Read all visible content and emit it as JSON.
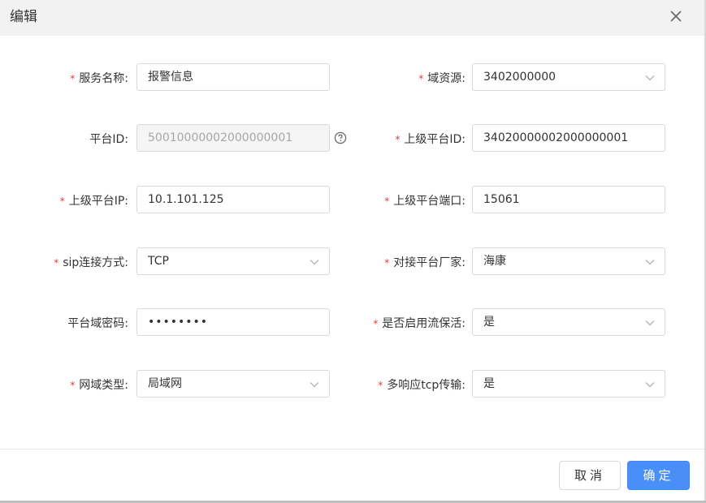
{
  "dialog": {
    "title": "编辑",
    "close_icon": "close-icon"
  },
  "form": {
    "service_name": {
      "label": "服务名称:",
      "required": true,
      "value": "报警信息"
    },
    "domain_source": {
      "label": "域资源:",
      "required": true,
      "value": "3402000000"
    },
    "platform_id": {
      "label": "平台ID:",
      "required": false,
      "value": "50010000002000000001",
      "disabled": true,
      "help_icon": "question-circle-icon"
    },
    "parent_platform_id": {
      "label": "上级平台ID:",
      "required": true,
      "value": "34020000002000000001"
    },
    "parent_platform_ip": {
      "label": "上级平台IP:",
      "required": true,
      "value": "10.1.101.125"
    },
    "parent_platform_port": {
      "label": "上级平台端口:",
      "required": true,
      "value": "15061"
    },
    "sip_connection": {
      "label": "sip连接方式:",
      "required": true,
      "value": "TCP"
    },
    "platform_vendor": {
      "label": "对接平台厂家:",
      "required": true,
      "value": "海康"
    },
    "domain_password": {
      "label": "平台域密码:",
      "required": false,
      "value": "••••••••"
    },
    "keepalive": {
      "label": "是否启用流保活:",
      "required": true,
      "value": "是"
    },
    "network_type": {
      "label": "网域类型:",
      "required": true,
      "value": "局域网"
    },
    "multi_response_tcp": {
      "label": "多响应tcp传输:",
      "required": true,
      "value": "是"
    }
  },
  "footer": {
    "cancel_label": "取消",
    "ok_label": "确定"
  },
  "colors": {
    "required_star": "#e33b3b",
    "primary_button": "#4a8ef7",
    "header_bg": "#f2f2f2"
  }
}
